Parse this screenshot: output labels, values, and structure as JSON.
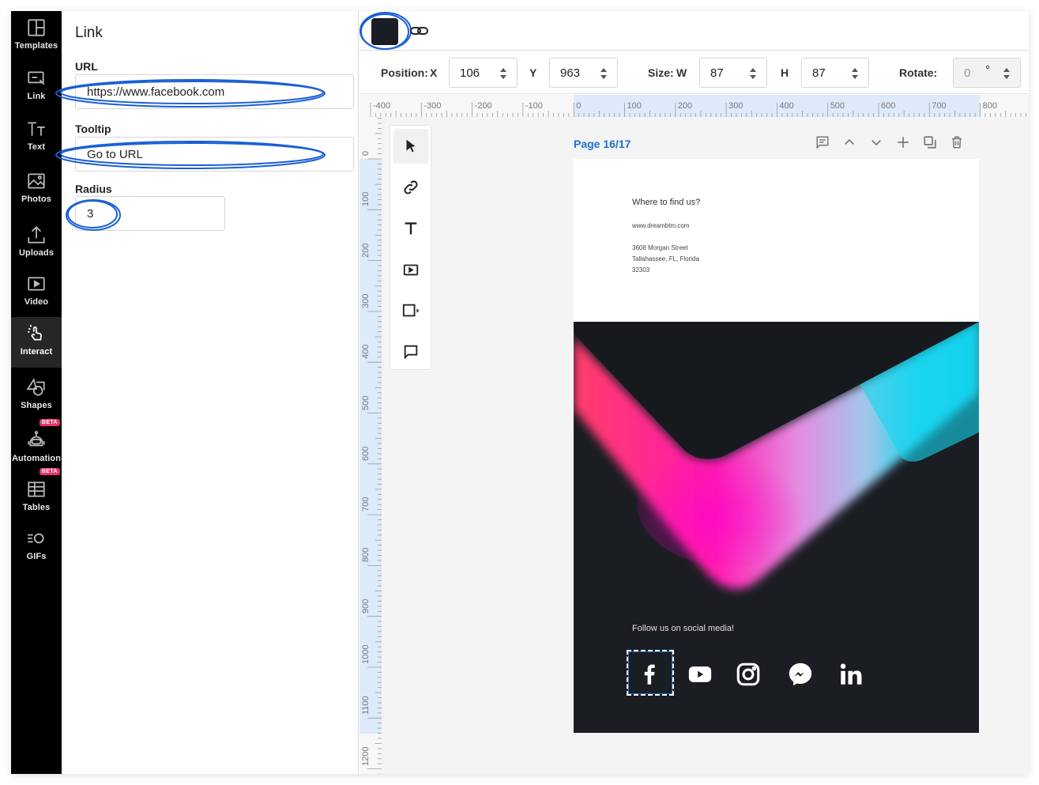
{
  "nav": {
    "items": [
      {
        "label": "Templates",
        "icon": "templates-icon"
      },
      {
        "label": "Link",
        "icon": "link-cursor-icon"
      },
      {
        "label": "Text",
        "icon": "text-icon"
      },
      {
        "label": "Photos",
        "icon": "photos-icon"
      },
      {
        "label": "Uploads",
        "icon": "upload-icon"
      },
      {
        "label": "Video",
        "icon": "video-icon"
      },
      {
        "label": "Interact",
        "icon": "interact-icon",
        "active": true
      },
      {
        "label": "Shapes",
        "icon": "shapes-icon"
      },
      {
        "label": "Automation",
        "icon": "robot-icon",
        "badge": "BETA"
      },
      {
        "label": "Tables",
        "icon": "table-icon",
        "badge": "BETA"
      },
      {
        "label": "GIFs",
        "icon": "gif-icon"
      }
    ]
  },
  "panel": {
    "title": "Link",
    "url_label": "URL",
    "url_value": "https://www.facebook.com",
    "tooltip_label": "Tooltip",
    "tooltip_value": "Go to URL",
    "radius_label": "Radius",
    "radius_value": "3"
  },
  "topbar": {
    "swatch_color": "#1a1d23"
  },
  "position": {
    "pos_label": "Position:",
    "x_label": "X",
    "x_value": "106",
    "y_label": "Y",
    "y_value": "963",
    "size_label": "Size:",
    "w_label": "W",
    "w_value": "87",
    "h_label": "H",
    "h_value": "87",
    "rotate_label": "Rotate:",
    "rotate_value": "0",
    "rotate_unit": "°"
  },
  "rulers": {
    "horizontal": [
      "-400",
      "-300",
      "-200",
      "-100",
      "0",
      "100",
      "200",
      "300",
      "400",
      "500",
      "600",
      "700",
      "800"
    ],
    "vertical": [
      "0",
      "100",
      "200",
      "300",
      "400",
      "500",
      "600",
      "700",
      "800",
      "900",
      "1000",
      "1100",
      "1200"
    ]
  },
  "canvas": {
    "page_label": "Page 16/17",
    "page": {
      "heading": "Where to find us?",
      "website": "www.dreambtm.com",
      "address_lines": [
        "3608 Morgan Street",
        "Tallahassee, FL, Florida",
        "32303"
      ],
      "follow_text": "Follow us on social media!",
      "socials": [
        "facebook",
        "youtube",
        "instagram",
        "messenger",
        "linkedin"
      ]
    }
  },
  "colors": {
    "accent": "#1d6fd1",
    "annotation": "#1a5fd6",
    "beta": "#e8336a",
    "nav_bg": "#000000"
  }
}
